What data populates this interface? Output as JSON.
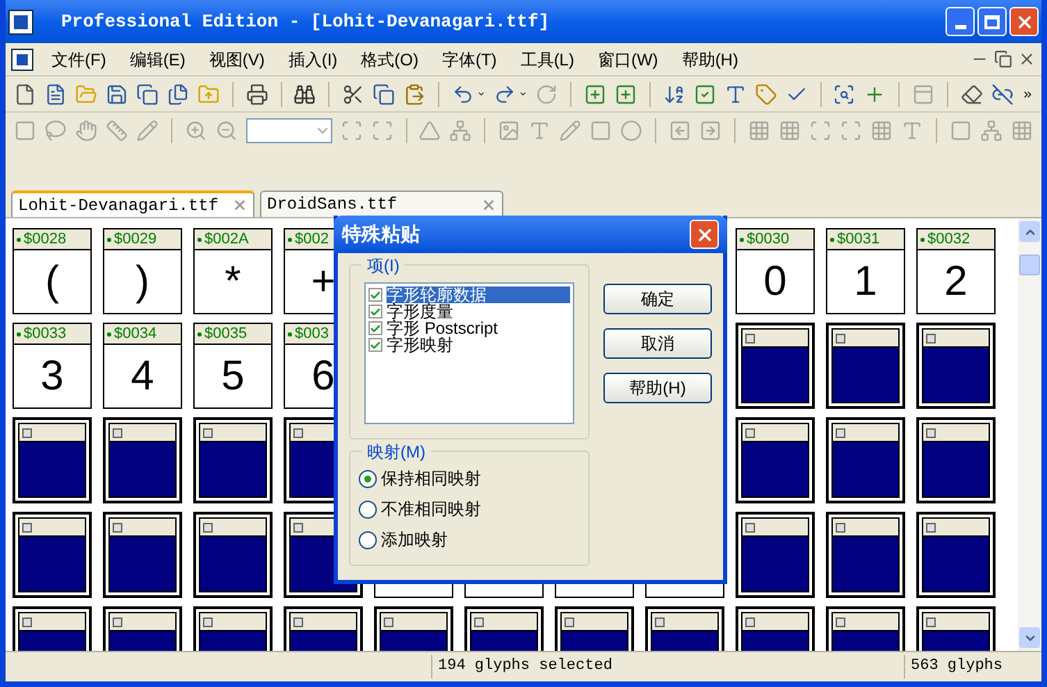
{
  "window": {
    "title": "Professional Edition - [Lohit-Devanagari.ttf]"
  },
  "menu": [
    "文件(F)",
    "编辑(E)",
    "视图(V)",
    "插入(I)",
    "格式(O)",
    "字体(T)",
    "工具(L)",
    "窗口(W)",
    "帮助(H)"
  ],
  "tabs": [
    {
      "label": "Lohit-Devanagari.ttf",
      "selected": true
    },
    {
      "label": "DroidSans.ttf",
      "selected": false
    }
  ],
  "grid": [
    [
      {
        "kind": "glyph",
        "code": "$0028",
        "char": "("
      },
      {
        "kind": "glyph",
        "code": "$0029",
        "char": ")"
      },
      {
        "kind": "glyph",
        "code": "$002A",
        "char": "*"
      },
      {
        "kind": "glyph",
        "code": "$002",
        "char": "+"
      },
      {
        "kind": "hidden"
      },
      {
        "kind": "hidden"
      },
      {
        "kind": "hidden"
      },
      {
        "kind": "hidden"
      },
      {
        "kind": "glyph",
        "code": "$0030",
        "char": "0"
      },
      {
        "kind": "glyph",
        "code": "$0031",
        "char": "1"
      },
      {
        "kind": "glyph",
        "code": "$0032",
        "char": "2"
      }
    ],
    [
      {
        "kind": "glyph",
        "code": "$0033",
        "char": "3"
      },
      {
        "kind": "glyph",
        "code": "$0034",
        "char": "4"
      },
      {
        "kind": "glyph",
        "code": "$0035",
        "char": "5"
      },
      {
        "kind": "glyph",
        "code": "$003",
        "char": "6"
      },
      {
        "kind": "covered"
      },
      {
        "kind": "covered"
      },
      {
        "kind": "covered"
      },
      {
        "kind": "covered"
      },
      {
        "kind": "empty"
      },
      {
        "kind": "empty"
      },
      {
        "kind": "empty"
      }
    ],
    [
      {
        "kind": "empty"
      },
      {
        "kind": "empty"
      },
      {
        "kind": "empty"
      },
      {
        "kind": "empty"
      },
      {
        "kind": "covered"
      },
      {
        "kind": "covered"
      },
      {
        "kind": "covered"
      },
      {
        "kind": "covered"
      },
      {
        "kind": "empty"
      },
      {
        "kind": "empty"
      },
      {
        "kind": "empty"
      }
    ],
    [
      {
        "kind": "empty"
      },
      {
        "kind": "empty"
      },
      {
        "kind": "empty"
      },
      {
        "kind": "empty"
      },
      {
        "kind": "covered"
      },
      {
        "kind": "covered"
      },
      {
        "kind": "covered"
      },
      {
        "kind": "covered"
      },
      {
        "kind": "empty"
      },
      {
        "kind": "empty"
      },
      {
        "kind": "empty"
      }
    ],
    [
      {
        "kind": "empty"
      },
      {
        "kind": "empty"
      },
      {
        "kind": "empty"
      },
      {
        "kind": "empty"
      },
      {
        "kind": "empty"
      },
      {
        "kind": "empty"
      },
      {
        "kind": "empty"
      },
      {
        "kind": "empty"
      },
      {
        "kind": "empty"
      },
      {
        "kind": "empty"
      },
      {
        "kind": "empty"
      }
    ]
  ],
  "dialog": {
    "title": "特殊粘贴",
    "items_group": "项(I)",
    "items": [
      {
        "label": "字形轮廓数据",
        "checked": true,
        "selected": true
      },
      {
        "label": "字形度量",
        "checked": true,
        "selected": false
      },
      {
        "label": "字形 Postscript",
        "checked": true,
        "selected": false
      },
      {
        "label": "字形映射",
        "checked": true,
        "selected": false
      }
    ],
    "buttons": [
      "确定",
      "取消",
      "帮助(H)"
    ],
    "mapping_group": "映射(M)",
    "mapping": [
      {
        "label": "保持相同映射",
        "selected": true
      },
      {
        "label": "不准相同映射",
        "selected": false
      },
      {
        "label": "添加映射",
        "selected": false
      }
    ]
  },
  "status_bar": {
    "selection": "194 glyphs selected",
    "total": "563 glyphs"
  }
}
